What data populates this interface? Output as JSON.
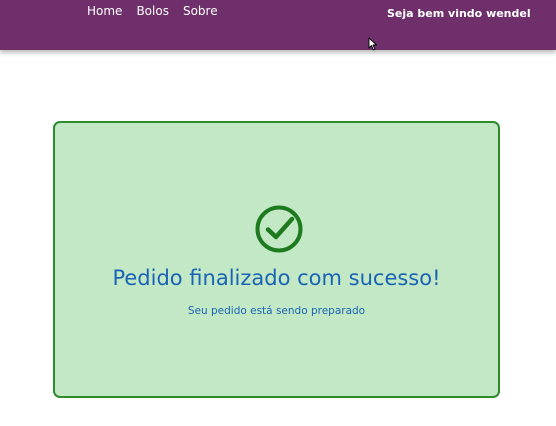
{
  "navbar": {
    "links": [
      {
        "label": "Home"
      },
      {
        "label": "Bolos"
      },
      {
        "label": "Sobre"
      }
    ],
    "welcome": "Seja bem vindo wendel",
    "background_color": "#6e2f6b"
  },
  "card": {
    "icon": "check-circle-icon",
    "title": "Pedido finalizado com sucesso!",
    "subtitle": "Seu pedido está sendo preparado",
    "background_color": "#c3e8c5",
    "border_color": "#2e8b2e",
    "icon_color": "#1e7a1e",
    "text_color": "#1a63b5"
  }
}
